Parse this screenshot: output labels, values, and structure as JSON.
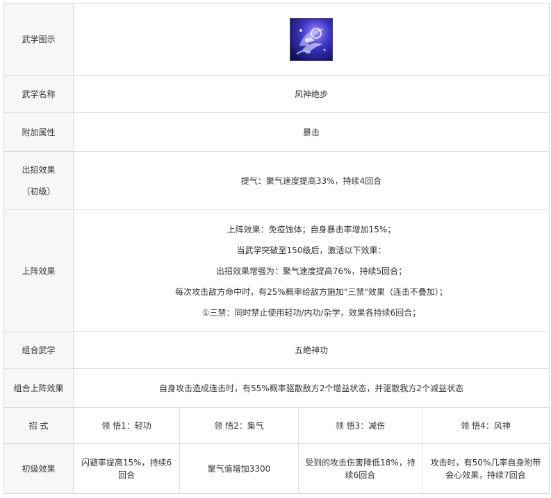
{
  "rows": {
    "icon": {
      "label": "武学图示",
      "icon_name": "wind-god-step-skill-icon"
    },
    "name": {
      "label": "武学名称",
      "value": "风神绝步"
    },
    "attribute": {
      "label": "附加属性",
      "value": "暴击"
    },
    "cast_effect": {
      "label_lines": [
        "出招效果",
        "（初级）"
      ],
      "value": "提气：聚气速度提高33%，持续4回合"
    },
    "formation_effect": {
      "label": "上阵效果",
      "lines": [
        "上阵效果：免疫蚀体；自身暴击率增加15%；",
        "当武学突破至150级后，激活以下效果：",
        "出招效果增强为：聚气速度提高76%，持续5回合；",
        "每次攻击敌方命中时，有25%概率给敌方施加\"三禁\"效果（连击不叠加）；",
        "①三禁：同时禁止使用轻功/内功/杂学，效果各持续6回合；"
      ]
    },
    "combo_skill": {
      "label": "组合武学",
      "value": "五绝神功"
    },
    "combo_effect": {
      "label": "组合上阵效果",
      "value": "自身攻击造成连击时，有55%概率驱散敌方2个增益状态，并驱散我方2个减益状态"
    },
    "moves": {
      "label": "招 式",
      "items": [
        "领 悟1：轻功",
        "领 悟2：集气",
        "领 悟3：减伤",
        "领 悟4：风神"
      ]
    },
    "basic_effect": {
      "label": "初级效果",
      "items": [
        "闪避率提高15%，持续6回合",
        "聚气值增加3300",
        "受到的攻击伤害降低18%，持续6回合",
        "攻击时，有50%几率自身附带会心效果，持续7回合"
      ]
    }
  },
  "colors": {
    "border": "#dcdcdc",
    "label_bg": "#f7f7f7",
    "text": "#333333",
    "icon_bg": "#2a2fa8",
    "icon_glow": "#c9d7ff"
  }
}
